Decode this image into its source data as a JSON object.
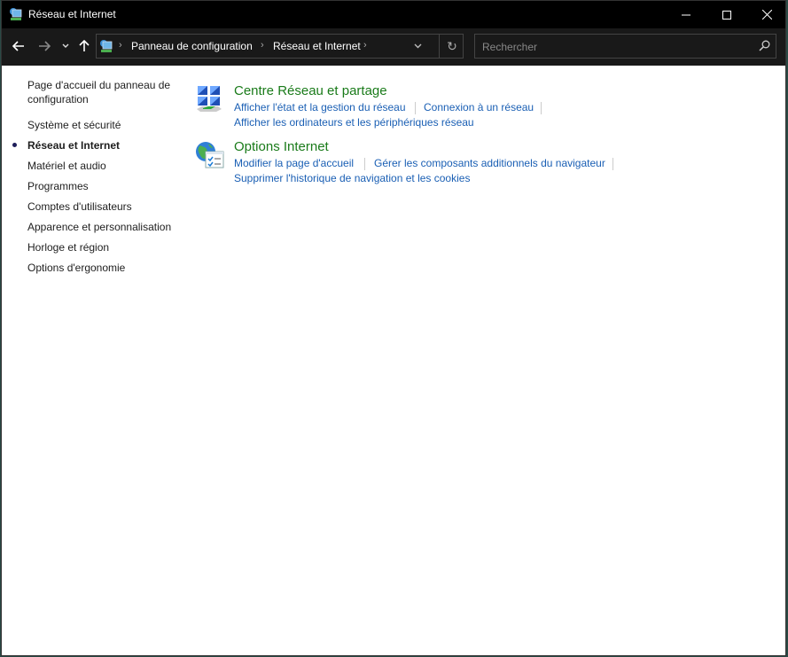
{
  "window": {
    "title": "Réseau et Internet",
    "controls": {
      "minimize": "minimize",
      "maximize": "maximize",
      "close": "close"
    }
  },
  "nav": {
    "back_icon": "arrow-left-icon",
    "forward_icon": "arrow-right-icon",
    "recent_icon": "chevron-down-icon",
    "up_icon": "arrow-up-icon",
    "breadcrumb": [
      "Panneau de configuration",
      "Réseau et Internet"
    ],
    "search_placeholder": "Rechercher"
  },
  "sidebar": {
    "items": [
      {
        "label": "Page d'accueil du panneau de configuration",
        "line1": "Page d'accueil du panneau de",
        "line2": "configuration",
        "active": false
      },
      {
        "label": "Système et sécurité",
        "active": false
      },
      {
        "label": "Réseau et Internet",
        "active": true
      },
      {
        "label": "Matériel et audio",
        "active": false
      },
      {
        "label": "Programmes",
        "active": false
      },
      {
        "label": "Comptes d'utilisateurs",
        "active": false
      },
      {
        "label": "Apparence et personnalisation",
        "active": false
      },
      {
        "label": "Horloge et région",
        "active": false
      },
      {
        "label": "Options d'ergonomie",
        "active": false
      }
    ]
  },
  "categories": [
    {
      "title": "Centre Réseau et partage",
      "icon": "network-center-icon",
      "links": [
        "Afficher l'état et la gestion du réseau",
        "Connexion à un réseau",
        "Afficher les ordinateurs et les périphériques réseau"
      ]
    },
    {
      "title": "Options Internet",
      "icon": "internet-options-icon",
      "links": [
        "Modifier la page d'accueil",
        "Gérer les composants additionnels du navigateur",
        "Supprimer l'historique de navigation et les cookies"
      ]
    }
  ],
  "colors": {
    "category_title": "#1a7b1a",
    "link": "#1a5fb4",
    "titlebar": "#000000",
    "navbar": "#191919"
  }
}
